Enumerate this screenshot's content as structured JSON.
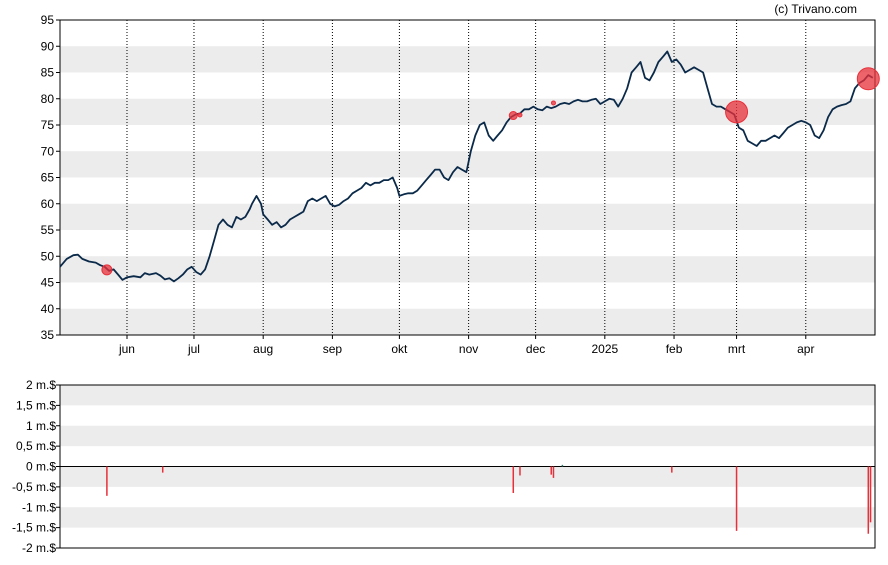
{
  "copyright": "(c) Trivano.com",
  "colors": {
    "price_line": "#0b2a4a",
    "band": "#ececec",
    "marker": "#e8303a",
    "bar_negative": "#e8303a",
    "bar_positive": "#2f7d6b",
    "axis": "#000000"
  },
  "chart_data": [
    {
      "type": "line",
      "name": "price",
      "ylim": [
        35,
        95
      ],
      "y_ticks": [
        35,
        40,
        45,
        50,
        55,
        60,
        65,
        70,
        75,
        80,
        85,
        90,
        95
      ],
      "x_range_days": [
        0,
        365
      ],
      "grid": "alternating horizontal bands, dotted vertical lines at month starts",
      "x_tick_labels": [
        {
          "label": "jun",
          "day": 30
        },
        {
          "label": "jul",
          "day": 60
        },
        {
          "label": "aug",
          "day": 91
        },
        {
          "label": "sep",
          "day": 122
        },
        {
          "label": "okt",
          "day": 152
        },
        {
          "label": "nov",
          "day": 183
        },
        {
          "label": "dec",
          "day": 213
        },
        {
          "label": "2025",
          "day": 244
        },
        {
          "label": "feb",
          "day": 275
        },
        {
          "label": "mrt",
          "day": 303
        },
        {
          "label": "apr",
          "day": 334
        }
      ],
      "points": [
        [
          0,
          48
        ],
        [
          3,
          49.5
        ],
        [
          6,
          50.2
        ],
        [
          8,
          50.3
        ],
        [
          10,
          49.5
        ],
        [
          13,
          49
        ],
        [
          16,
          48.8
        ],
        [
          18,
          48.3
        ],
        [
          20,
          48
        ],
        [
          22,
          47.2
        ],
        [
          24,
          47.5
        ],
        [
          26,
          46.5
        ],
        [
          28,
          45.5
        ],
        [
          30,
          46
        ],
        [
          33,
          46.2
        ],
        [
          36,
          46
        ],
        [
          38,
          46.8
        ],
        [
          40,
          46.5
        ],
        [
          43,
          46.8
        ],
        [
          45,
          46.3
        ],
        [
          47,
          45.6
        ],
        [
          49,
          45.8
        ],
        [
          51,
          45.2
        ],
        [
          53,
          45.8
        ],
        [
          55,
          46.5
        ],
        [
          57,
          47.5
        ],
        [
          59,
          48
        ],
        [
          61,
          47
        ],
        [
          63,
          46.5
        ],
        [
          65,
          47.5
        ],
        [
          67,
          50
        ],
        [
          69,
          53
        ],
        [
          71,
          56
        ],
        [
          73,
          57
        ],
        [
          75,
          56
        ],
        [
          77,
          55.5
        ],
        [
          79,
          57.5
        ],
        [
          81,
          57
        ],
        [
          83,
          57.5
        ],
        [
          85,
          59
        ],
        [
          86,
          60
        ],
        [
          88,
          61.5
        ],
        [
          90,
          60
        ],
        [
          91,
          58
        ],
        [
          93,
          57
        ],
        [
          95,
          56
        ],
        [
          97,
          56.5
        ],
        [
          99,
          55.5
        ],
        [
          101,
          56
        ],
        [
          103,
          57
        ],
        [
          105,
          57.5
        ],
        [
          107,
          58
        ],
        [
          109,
          58.5
        ],
        [
          111,
          60.5
        ],
        [
          113,
          61
        ],
        [
          115,
          60.5
        ],
        [
          117,
          61
        ],
        [
          119,
          61.5
        ],
        [
          121,
          60
        ],
        [
          123,
          59.5
        ],
        [
          125,
          59.8
        ],
        [
          127,
          60.5
        ],
        [
          129,
          61
        ],
        [
          131,
          62
        ],
        [
          133,
          62.5
        ],
        [
          135,
          63
        ],
        [
          137,
          64
        ],
        [
          139,
          63.5
        ],
        [
          141,
          64
        ],
        [
          143,
          64
        ],
        [
          145,
          64.5
        ],
        [
          147,
          64.5
        ],
        [
          149,
          65
        ],
        [
          151,
          63
        ],
        [
          152,
          61.5
        ],
        [
          154,
          61.8
        ],
        [
          156,
          62
        ],
        [
          158,
          62
        ],
        [
          160,
          62.5
        ],
        [
          162,
          63.5
        ],
        [
          164,
          64.5
        ],
        [
          166,
          65.5
        ],
        [
          168,
          66.5
        ],
        [
          170,
          66.5
        ],
        [
          172,
          65
        ],
        [
          174,
          64.5
        ],
        [
          176,
          66
        ],
        [
          178,
          67
        ],
        [
          180,
          66.5
        ],
        [
          182,
          66
        ],
        [
          184,
          70
        ],
        [
          186,
          73
        ],
        [
          188,
          75
        ],
        [
          190,
          75.5
        ],
        [
          192,
          73
        ],
        [
          194,
          72
        ],
        [
          196,
          73
        ],
        [
          198,
          74
        ],
        [
          200,
          75.5
        ],
        [
          202,
          76.5
        ],
        [
          204,
          77
        ],
        [
          206,
          77.2
        ],
        [
          208,
          78
        ],
        [
          210,
          78
        ],
        [
          212,
          78.5
        ],
        [
          214,
          78
        ],
        [
          216,
          77.8
        ],
        [
          218,
          78.5
        ],
        [
          220,
          78.2
        ],
        [
          222,
          78.5
        ],
        [
          224,
          79
        ],
        [
          226,
          79.2
        ],
        [
          228,
          79
        ],
        [
          230,
          79.5
        ],
        [
          232,
          79.8
        ],
        [
          234,
          79.5
        ],
        [
          236,
          79.5
        ],
        [
          238,
          79.8
        ],
        [
          240,
          80
        ],
        [
          242,
          79
        ],
        [
          244,
          79.5
        ],
        [
          246,
          80
        ],
        [
          248,
          79.8
        ],
        [
          250,
          78.5
        ],
        [
          252,
          80
        ],
        [
          254,
          82
        ],
        [
          256,
          85
        ],
        [
          258,
          86
        ],
        [
          260,
          87
        ],
        [
          262,
          84
        ],
        [
          264,
          83.5
        ],
        [
          266,
          85
        ],
        [
          268,
          87
        ],
        [
          270,
          88
        ],
        [
          272,
          89
        ],
        [
          274,
          87
        ],
        [
          276,
          87.5
        ],
        [
          278,
          86.5
        ],
        [
          280,
          85
        ],
        [
          282,
          85.5
        ],
        [
          284,
          86
        ],
        [
          286,
          85.5
        ],
        [
          288,
          85
        ],
        [
          290,
          82
        ],
        [
          292,
          79
        ],
        [
          294,
          78.5
        ],
        [
          296,
          78.5
        ],
        [
          298,
          78
        ],
        [
          300,
          77.5
        ],
        [
          302,
          77
        ],
        [
          304,
          74.5
        ],
        [
          306,
          74
        ],
        [
          308,
          72
        ],
        [
          310,
          71.5
        ],
        [
          312,
          71
        ],
        [
          314,
          72
        ],
        [
          316,
          72
        ],
        [
          318,
          72.5
        ],
        [
          320,
          73
        ],
        [
          322,
          72.5
        ],
        [
          324,
          73.5
        ],
        [
          326,
          74.5
        ],
        [
          328,
          75
        ],
        [
          330,
          75.5
        ],
        [
          332,
          75.8
        ],
        [
          334,
          75.5
        ],
        [
          336,
          75
        ],
        [
          338,
          73
        ],
        [
          340,
          72.5
        ],
        [
          342,
          74
        ],
        [
          344,
          76.5
        ],
        [
          346,
          78
        ],
        [
          348,
          78.5
        ],
        [
          350,
          78.8
        ],
        [
          352,
          79
        ],
        [
          354,
          79.5
        ],
        [
          356,
          82
        ],
        [
          358,
          83
        ],
        [
          360,
          83.5
        ],
        [
          362,
          84.5
        ],
        [
          364,
          84
        ]
      ],
      "markers": [
        {
          "x": 21,
          "y": 47.4,
          "size": "medium"
        },
        {
          "x": 203,
          "y": 76.8,
          "size": "small"
        },
        {
          "x": 206,
          "y": 76.9,
          "size": "tiny"
        },
        {
          "x": 221,
          "y": 79.2,
          "size": "tiny"
        },
        {
          "x": 303,
          "y": 77.5,
          "size": "large"
        },
        {
          "x": 362,
          "y": 83.8,
          "size": "large"
        }
      ]
    },
    {
      "type": "bar",
      "name": "insider",
      "ylim": [
        -2,
        2
      ],
      "y_tick_labels": [
        {
          "value": 2,
          "label": "2 m.$"
        },
        {
          "value": 1.5,
          "label": "1,5 m.$"
        },
        {
          "value": 1,
          "label": "1 m.$"
        },
        {
          "value": 0.5,
          "label": "0,5 m.$"
        },
        {
          "value": 0,
          "label": "0 m.$"
        },
        {
          "value": -0.5,
          "label": "-0,5 m.$"
        },
        {
          "value": -1,
          "label": "-1 m.$"
        },
        {
          "value": -1.5,
          "label": "-1,5 m.$"
        },
        {
          "value": -2,
          "label": "-2 m.$"
        }
      ],
      "bars": [
        {
          "x": 21,
          "value": -0.72
        },
        {
          "x": 46,
          "value": -0.15
        },
        {
          "x": 203,
          "value": -0.65
        },
        {
          "x": 206,
          "value": -0.22
        },
        {
          "x": 220,
          "value": -0.2
        },
        {
          "x": 221,
          "value": -0.28
        },
        {
          "x": 225,
          "value": 0.04
        },
        {
          "x": 274,
          "value": -0.15
        },
        {
          "x": 303,
          "value": -1.58
        },
        {
          "x": 362,
          "value": -1.65
        },
        {
          "x": 363,
          "value": -1.37
        }
      ]
    }
  ]
}
